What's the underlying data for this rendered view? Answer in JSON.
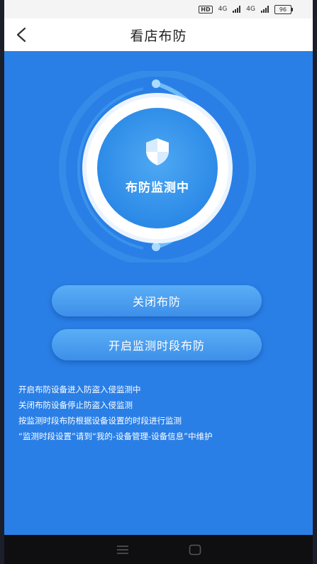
{
  "status_bar": {
    "hd": "HD",
    "network_1": "4G",
    "network_2": "4G",
    "battery": "96"
  },
  "header": {
    "title": "看店布防",
    "back_icon": "chevron-left-icon"
  },
  "shield": {
    "status_text": "布防监测中",
    "icon": "shield-icon",
    "colors": {
      "ring": "#4aa0ef",
      "inner": "#2f8fe9",
      "white": "#ffffff"
    }
  },
  "actions": {
    "primary_label": "关闭布防",
    "secondary_label": "开启监测时段布防"
  },
  "notes": [
    "开启布防设备进入防盗入侵监测中",
    "关闭布防设备停止防盗入侵监测",
    "按监测时段布防根据设备设置的时段进行监测",
    "“监测时段设置”请到“我的-设备管理-设备信息”中维护"
  ],
  "nav": {
    "menu_icon": "menu-icon",
    "home_icon": "home-icon"
  },
  "theme": {
    "background": "#2a7fe6",
    "button": "#4b9ff0"
  }
}
